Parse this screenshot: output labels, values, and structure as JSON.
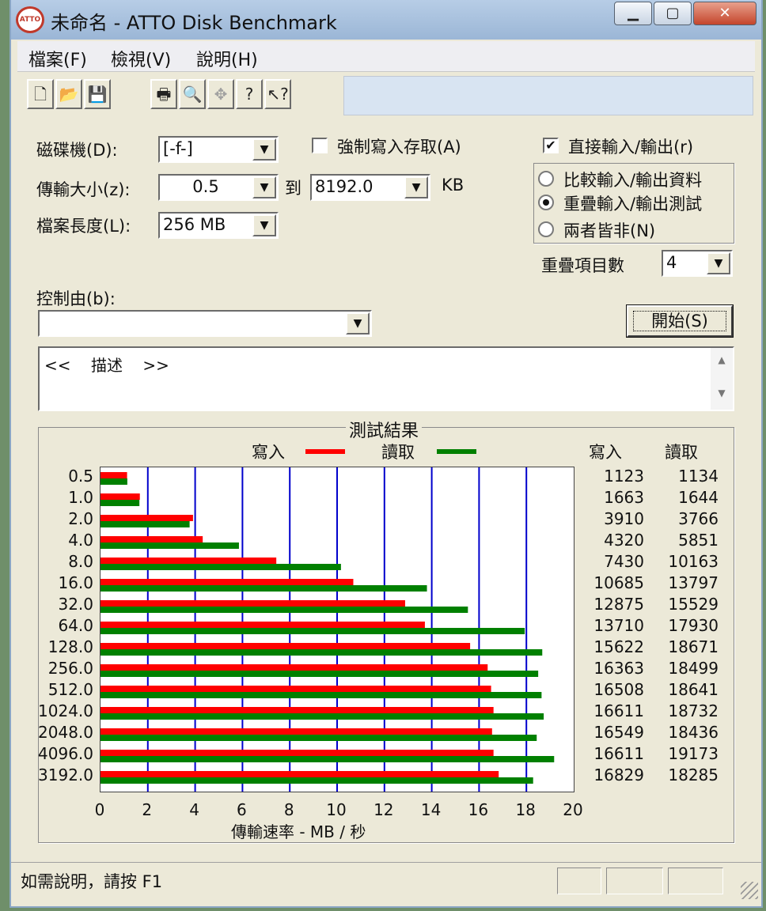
{
  "window": {
    "title": "未命名 - ATTO Disk Benchmark",
    "minimize_label": "▁",
    "maximize_label": "▢",
    "close_label": "✕"
  },
  "menu": {
    "items": [
      "檔案(F)",
      "檢視(V)",
      "說明(H)"
    ]
  },
  "toolbar": {
    "buttons": [
      "new-file-icon",
      "open-folder-icon",
      "save-disk-icon",
      "print-icon",
      "print-preview-icon",
      "move-icon",
      "help-icon",
      "context-help-icon"
    ]
  },
  "settings": {
    "drive_label": "磁碟機(D):",
    "drive_value": "[-f-]",
    "transfer_label": "傳輸大小(z):",
    "transfer_from": "0.5",
    "to_label": "到",
    "transfer_to": "8192.0",
    "kb_label": "KB",
    "file_length_label": "檔案長度(L):",
    "file_length_value": "256 MB",
    "force_write_label": "強制寫入存取(A)",
    "force_write_checked": false,
    "direct_io_label": "直接輸入/輸出(r)",
    "direct_io_checked": true,
    "radio_options": [
      "比較輸入/輸出資料",
      "重疊輸入/輸出測試",
      "兩者皆非(N)"
    ],
    "radio_selected": 1,
    "queue_label": "重疊項目數",
    "queue_value": "4",
    "controlled_by_label": "控制由(b):",
    "controlled_by_value": "",
    "start_button": "開始(S)",
    "description_text": "<<    描述    >>"
  },
  "results": {
    "group_title": "測試結果",
    "legend_write": "寫入",
    "legend_read": "讀取",
    "col_write": "寫入",
    "col_read": "讀取",
    "xlabel": "傳輸速率 - MB / 秒",
    "colors": {
      "write": "#ff0000",
      "read": "#008000",
      "grid": "#0000cc"
    }
  },
  "chart_data": {
    "type": "bar",
    "categories": [
      "0.5",
      "1.0",
      "2.0",
      "4.0",
      "8.0",
      "16.0",
      "32.0",
      "64.0",
      "128.0",
      "256.0",
      "512.0",
      "1024.0",
      "2048.0",
      "4096.0",
      "3192.0"
    ],
    "series": [
      {
        "name": "寫入",
        "values": [
          1123,
          1663,
          3910,
          4320,
          7430,
          10685,
          12875,
          13710,
          15622,
          16363,
          16508,
          16611,
          16549,
          16611,
          16829
        ]
      },
      {
        "name": "讀取",
        "values": [
          1134,
          1644,
          3766,
          5851,
          10163,
          13797,
          15529,
          17930,
          18671,
          18499,
          18641,
          18732,
          18436,
          19173,
          18285
        ]
      }
    ],
    "xticks": [
      "0",
      "2",
      "4",
      "6",
      "8",
      "10",
      "12",
      "14",
      "16",
      "18",
      "20"
    ],
    "xlim": [
      0,
      20
    ],
    "xlabel": "傳輸速率 - MB / 秒",
    "grid": true
  },
  "status": {
    "text": "如需說明，請按 F1"
  }
}
